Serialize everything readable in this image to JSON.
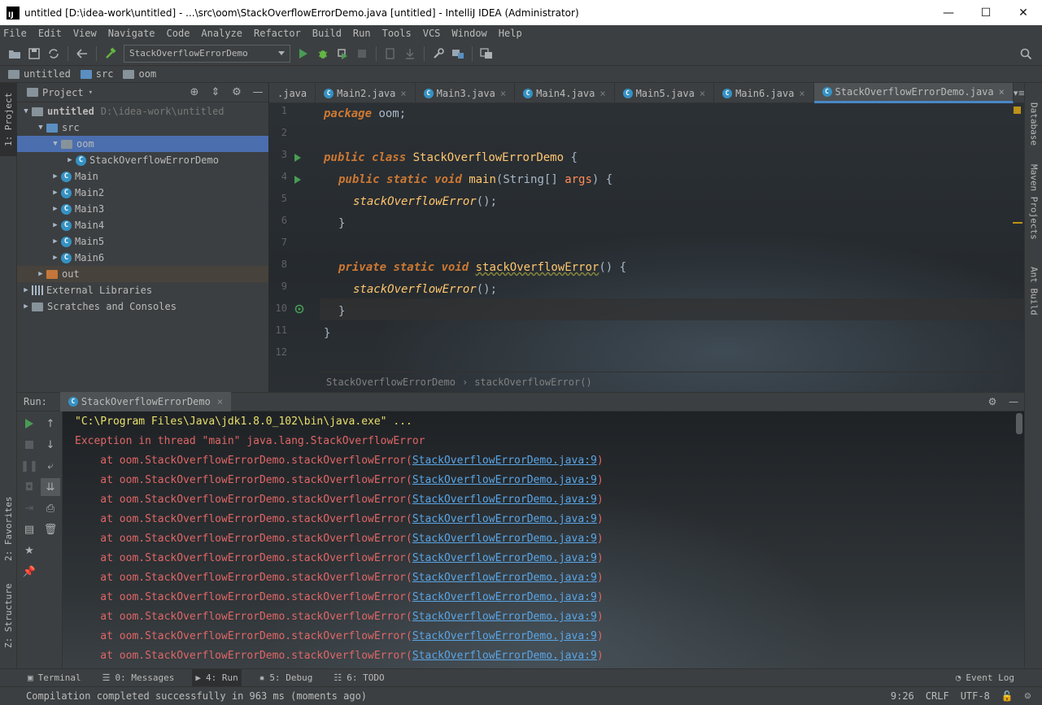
{
  "window": {
    "title": "untitled [D:\\idea-work\\untitled] - ...\\src\\oom\\StackOverflowErrorDemo.java [untitled] - IntelliJ IDEA (Administrator)",
    "app_icon_text": "IJ",
    "minimize": "—",
    "maximize": "☐",
    "close": "✕"
  },
  "menu": [
    "File",
    "Edit",
    "View",
    "Navigate",
    "Code",
    "Analyze",
    "Refactor",
    "Build",
    "Run",
    "Tools",
    "VCS",
    "Window",
    "Help"
  ],
  "toolbar": {
    "run_config": "StackOverflowErrorDemo"
  },
  "breadcrumbs": [
    "untitled",
    "src",
    "oom"
  ],
  "project": {
    "title": "Project",
    "tree": [
      {
        "label": "untitled",
        "hint": "D:\\idea-work\\untitled"
      },
      {
        "label": "src"
      },
      {
        "label": "oom"
      },
      {
        "label": "StackOverflowErrorDemo"
      },
      {
        "label": "Main"
      },
      {
        "label": "Main2"
      },
      {
        "label": "Main3"
      },
      {
        "label": "Main4"
      },
      {
        "label": "Main5"
      },
      {
        "label": "Main6"
      },
      {
        "label": "out"
      },
      {
        "label": "External Libraries"
      },
      {
        "label": "Scratches and Consoles"
      }
    ]
  },
  "editor": {
    "tabs": [
      ".java",
      "Main2.java",
      "Main3.java",
      "Main4.java",
      "Main5.java",
      "Main6.java",
      "StackOverflowErrorDemo.java"
    ],
    "active_tab": "StackOverflowErrorDemo.java",
    "tabs_menu": "▾≡₁",
    "line_numbers": [
      "1",
      "2",
      "3",
      "4",
      "5",
      "6",
      "7",
      "8",
      "9",
      "10",
      "11",
      "12"
    ],
    "code": {
      "l1_kw": "package",
      "l1_rest": " oom;",
      "l3_kw1": "public",
      "l3_kw2": "class",
      "l3_name": "StackOverflowErrorDemo",
      "l3_rest": " {",
      "l4_kw1": "public",
      "l4_kw2": "static",
      "l4_kw3": "void",
      "l4_name": "main",
      "l4_p1": "(String[] ",
      "l4_param": "args",
      "l4_p2": ") {",
      "l5_call": "stackOverflowError",
      "l5_rest": "();",
      "l6": "}",
      "l8_kw1": "private",
      "l8_kw2": "static",
      "l8_kw3": "void",
      "l8_name": "stackOverflowError",
      "l8_rest": "() {",
      "l9_call": "stackOverflowError",
      "l9_rest": "();",
      "l10": "}",
      "l11": "}"
    },
    "crumb_class": "StackOverflowErrorDemo",
    "crumb_method": "stackOverflowError()"
  },
  "run": {
    "label": "Run:",
    "tab": "StackOverflowErrorDemo",
    "command": "\"C:\\Program Files\\Java\\jdk1.8.0_102\\bin\\java.exe\" ...",
    "exception": "Exception in thread \"main\" java.lang.StackOverflowError",
    "frame_prefix": "    at oom.StackOverflowErrorDemo.stackOverflowError(",
    "frame_link": "StackOverflowErrorDemo.java:9",
    "frame_suffix": ")"
  },
  "side_tabs": {
    "project": "1: Project",
    "favorites": "2: Favorites",
    "structure": "Z: Structure",
    "database": "Database",
    "maven": "Maven Projects",
    "ant": "Ant Build"
  },
  "bottom_tabs": {
    "terminal": "Terminal",
    "messages": "0: Messages",
    "run": "4: Run",
    "debug": "5: Debug",
    "todo": "6: TODO",
    "event_log": "Event Log"
  },
  "status": {
    "message": "Compilation completed successfully in 963 ms (moments ago)",
    "position": "9:26",
    "line_sep": "CRLF",
    "encoding": "UTF-8"
  }
}
